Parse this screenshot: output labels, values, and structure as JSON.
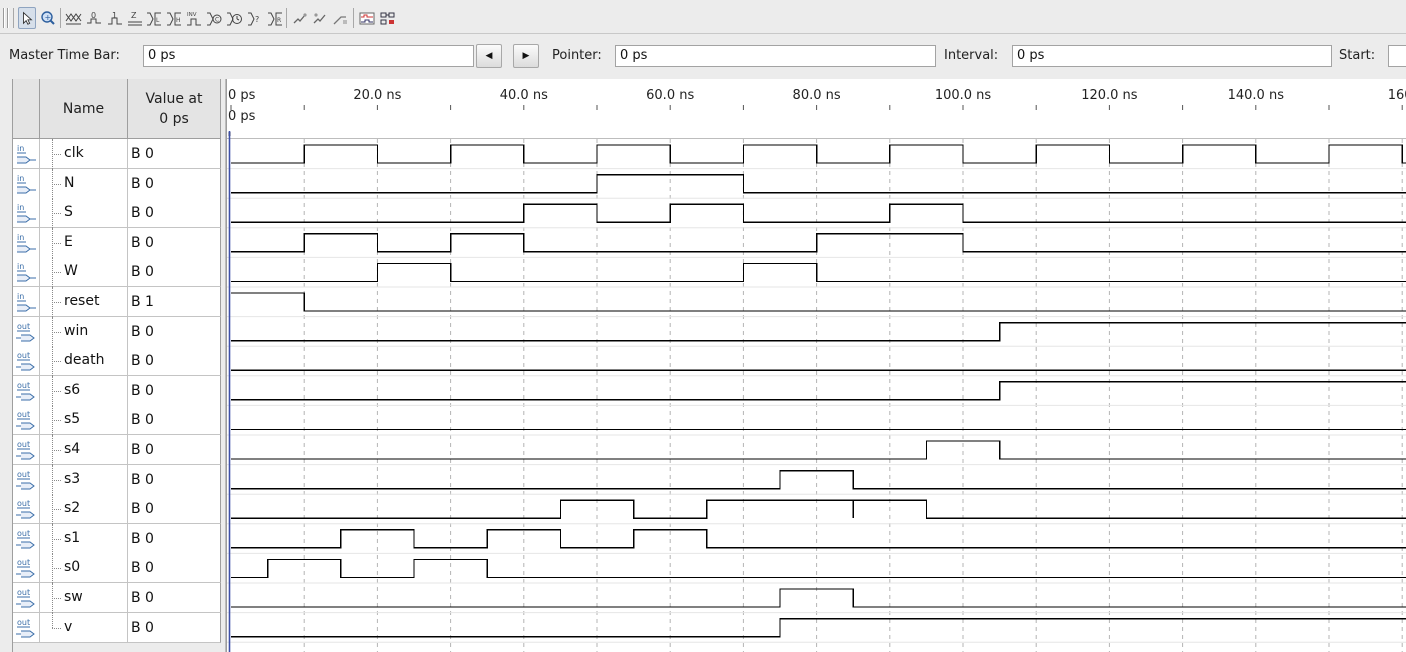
{
  "toolbar": {
    "buttons": [
      {
        "icon": "selection-tool-icon",
        "active": true
      },
      {
        "icon": "zoom-tool-icon"
      },
      {
        "icon": "forcing-unknown-icon"
      },
      {
        "icon": "forcing-low-icon"
      },
      {
        "icon": "forcing-high-icon"
      },
      {
        "icon": "high-impedance-icon"
      },
      {
        "icon": "weak-low-icon"
      },
      {
        "icon": "weak-high-icon"
      },
      {
        "icon": "invert-icon"
      },
      {
        "icon": "count-value-icon"
      },
      {
        "icon": "clock-icon"
      },
      {
        "icon": "random-value-icon"
      },
      {
        "icon": "arbitrary-value-icon"
      },
      {
        "icon": "snap-to-transition-icon"
      },
      {
        "icon": "snap-to-grid-icon"
      },
      {
        "icon": "grid-icon"
      },
      {
        "icon": "waveform-compare-icon"
      },
      {
        "icon": "timing-analysis-icon"
      }
    ]
  },
  "timebar": {
    "master_label": "Master Time Bar:",
    "master_value": "0 ps",
    "pointer_label": "Pointer:",
    "pointer_value": "0 ps",
    "interval_label": "Interval:",
    "interval_value": "0 ps",
    "start_label": "Start:",
    "start_value": ""
  },
  "table": {
    "name_header": "Name",
    "value_header_line1": "Value at",
    "value_header_line2": "0 ps"
  },
  "ruler": {
    "ticks": [
      "0 ps",
      "20.0 ns",
      "40.0 ns",
      "60.0 ns",
      "80.0 ns",
      "100.0 ns",
      "120.0 ns",
      "140.0 ns",
      "160."
    ],
    "cursor_label": "0 ps"
  },
  "time_axis": {
    "unit": "ns",
    "tick_step": 20
  },
  "signals": [
    {
      "dir": "in",
      "pin": "in",
      "name": "clk",
      "value": "B 0",
      "clock_period": 20,
      "transitions": [
        {
          "t": 0,
          "v": 0
        }
      ]
    },
    {
      "dir": "in",
      "pin": "in",
      "name": "N",
      "value": "B 0",
      "transitions": [
        {
          "t": 0,
          "v": 0
        },
        {
          "t": 50,
          "v": 1
        },
        {
          "t": 70,
          "v": 0
        }
      ]
    },
    {
      "dir": "in",
      "pin": "in",
      "name": "S",
      "value": "B 0",
      "transitions": [
        {
          "t": 0,
          "v": 0
        },
        {
          "t": 40,
          "v": 1
        },
        {
          "t": 50,
          "v": 0
        },
        {
          "t": 60,
          "v": 1
        },
        {
          "t": 70,
          "v": 0
        },
        {
          "t": 90,
          "v": 1
        },
        {
          "t": 100,
          "v": 0
        }
      ]
    },
    {
      "dir": "in",
      "pin": "in",
      "name": "E",
      "value": "B 0",
      "transitions": [
        {
          "t": 0,
          "v": 0
        },
        {
          "t": 10,
          "v": 1
        },
        {
          "t": 20,
          "v": 0
        },
        {
          "t": 30,
          "v": 1
        },
        {
          "t": 40,
          "v": 0
        },
        {
          "t": 80,
          "v": 1
        },
        {
          "t": 100,
          "v": 0
        }
      ]
    },
    {
      "dir": "in",
      "pin": "in",
      "name": "W",
      "value": "B 0",
      "transitions": [
        {
          "t": 0,
          "v": 0
        },
        {
          "t": 20,
          "v": 1
        },
        {
          "t": 30,
          "v": 0
        },
        {
          "t": 70,
          "v": 1
        },
        {
          "t": 80,
          "v": 0
        }
      ]
    },
    {
      "dir": "in",
      "pin": "in",
      "name": "reset",
      "value": "B 1",
      "transitions": [
        {
          "t": 0,
          "v": 1
        },
        {
          "t": 10,
          "v": 0
        }
      ]
    },
    {
      "dir": "out",
      "pin": "out",
      "name": "win",
      "value": "B 0",
      "transitions": [
        {
          "t": 0,
          "v": 0
        },
        {
          "t": 105,
          "v": 1
        }
      ]
    },
    {
      "dir": "out",
      "pin": "out",
      "name": "death",
      "value": "B 0",
      "transitions": [
        {
          "t": 0,
          "v": 0
        }
      ]
    },
    {
      "dir": "out",
      "pin": "out",
      "name": "s6",
      "value": "B 0",
      "transitions": [
        {
          "t": 0,
          "v": 0
        },
        {
          "t": 105,
          "v": 1
        }
      ]
    },
    {
      "dir": "out",
      "pin": "out",
      "name": "s5",
      "value": "B 0",
      "transitions": [
        {
          "t": 0,
          "v": 0
        }
      ]
    },
    {
      "dir": "out",
      "pin": "out",
      "name": "s4",
      "value": "B 0",
      "transitions": [
        {
          "t": 0,
          "v": 0
        },
        {
          "t": 95,
          "v": 1
        },
        {
          "t": 105,
          "v": 0
        }
      ]
    },
    {
      "dir": "out",
      "pin": "out",
      "name": "s3",
      "value": "B 0",
      "transitions": [
        {
          "t": 0,
          "v": 0
        },
        {
          "t": 75,
          "v": 1
        },
        {
          "t": 85,
          "v": 0
        }
      ]
    },
    {
      "dir": "out",
      "pin": "out",
      "name": "s2",
      "value": "B 0",
      "transitions": [
        {
          "t": 0,
          "v": 0
        },
        {
          "t": 45,
          "v": 1
        },
        {
          "t": 55,
          "v": 0
        },
        {
          "t": 65,
          "v": 1
        },
        {
          "t": 85,
          "v": 0
        },
        {
          "t": 85,
          "v": 1
        },
        {
          "t": 95,
          "v": 0
        }
      ]
    },
    {
      "dir": "out",
      "pin": "out",
      "name": "s1",
      "value": "B 0",
      "transitions": [
        {
          "t": 0,
          "v": 0
        },
        {
          "t": 15,
          "v": 1
        },
        {
          "t": 25,
          "v": 0
        },
        {
          "t": 35,
          "v": 1
        },
        {
          "t": 45,
          "v": 0
        },
        {
          "t": 55,
          "v": 1
        },
        {
          "t": 65,
          "v": 0
        }
      ]
    },
    {
      "dir": "out",
      "pin": "out",
      "name": "s0",
      "value": "B 0",
      "transitions": [
        {
          "t": 0,
          "v": 0
        },
        {
          "t": 5,
          "v": 1
        },
        {
          "t": 15,
          "v": 0
        },
        {
          "t": 25,
          "v": 1
        },
        {
          "t": 35,
          "v": 0
        }
      ]
    },
    {
      "dir": "out",
      "pin": "out",
      "name": "sw",
      "value": "B 0",
      "transitions": [
        {
          "t": 0,
          "v": 0
        },
        {
          "t": 75,
          "v": 1
        },
        {
          "t": 85,
          "v": 0
        }
      ]
    },
    {
      "dir": "out",
      "pin": "out",
      "name": "v",
      "value": "B 0",
      "transitions": [
        {
          "t": 0,
          "v": 0
        },
        {
          "t": 75,
          "v": 1
        }
      ]
    }
  ],
  "colors": {
    "waveform": "#000000",
    "grid": "#b4b4b4",
    "cursor": "#3d4fa8",
    "pin_icon": "#3b6ea8"
  }
}
